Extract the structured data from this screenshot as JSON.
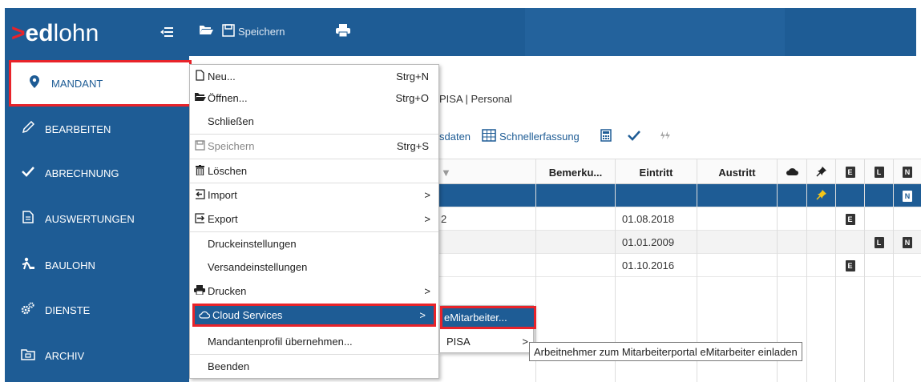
{
  "app": {
    "logo_arrow": ">",
    "logo_ed": "ed",
    "logo_lohn": "lohn",
    "menu_toggle_icon": "hamburger-icon"
  },
  "toolbar": {
    "open_icon": "folder-open-icon",
    "save_label": "Speichern",
    "print_icon": "printer-icon"
  },
  "sidebar": {
    "items": [
      {
        "label": "MANDANT",
        "icon": "map-marker-icon"
      },
      {
        "label": "BEARBEITEN",
        "icon": "pencil-icon"
      },
      {
        "label": "ABRECHNUNG",
        "icon": "checkmark-icon"
      },
      {
        "label": "AUSWERTUNGEN",
        "icon": "document-icon"
      },
      {
        "label": "BAULOHN",
        "icon": "worker-icon"
      },
      {
        "label": "DIENSTE",
        "icon": "gears-icon"
      },
      {
        "label": "ARCHIV",
        "icon": "archive-icon"
      }
    ]
  },
  "main": {
    "breadcrumb": "PISA | Personal",
    "toolbar": {
      "stammdaten_partial": "sdaten",
      "schnellerfassung": "Schnellerfassung"
    },
    "grid": {
      "headers": [
        "Bemerku...",
        "Eintritt",
        "Austritt"
      ],
      "header_sort_arrow": "▼",
      "icon_headers": [
        "cloud-icon",
        "pin-icon",
        "E",
        "L",
        "N"
      ],
      "rows": [
        {
          "partial": "",
          "bemerkung": "",
          "eintritt": "",
          "austritt": "",
          "pin": true,
          "E": false,
          "L": false,
          "N": true
        },
        {
          "partial": "2",
          "bemerkung": "",
          "eintritt": "01.08.2018",
          "austritt": "",
          "pin": false,
          "E": true,
          "L": false,
          "N": false
        },
        {
          "partial": "",
          "bemerkung": "",
          "eintritt": "01.01.2009",
          "austritt": "",
          "pin": false,
          "E": false,
          "L": true,
          "N": true
        },
        {
          "partial": "",
          "bemerkung": "",
          "eintritt": "01.10.2016",
          "austritt": "",
          "pin": false,
          "E": true,
          "L": false,
          "N": false
        }
      ]
    }
  },
  "menu": {
    "items": [
      {
        "label": "Neu...",
        "shortcut": "Strg+N",
        "icon": "new-file-icon"
      },
      {
        "label": "Öffnen...",
        "shortcut": "Strg+O",
        "icon": "folder-open-icon"
      },
      {
        "label": "Schließen",
        "shortcut": ""
      },
      {
        "label": "Speichern",
        "shortcut": "Strg+S",
        "icon": "save-icon"
      },
      {
        "label": "Löschen",
        "shortcut": "",
        "icon": "trash-icon"
      },
      {
        "label": "Import",
        "shortcut": "",
        "icon": "import-icon"
      },
      {
        "label": "Export",
        "shortcut": "",
        "icon": "export-icon"
      },
      {
        "label": "Druckeinstellungen",
        "shortcut": ""
      },
      {
        "label": "Versandeinstellungen",
        "shortcut": ""
      },
      {
        "label": "Drucken",
        "shortcut": "",
        "icon": "printer-icon"
      },
      {
        "label": "Cloud Services",
        "shortcut": "",
        "icon": "cloud-icon"
      },
      {
        "label": "Mandantenprofil übernehmen...",
        "shortcut": ""
      },
      {
        "label": "Beenden",
        "shortcut": ""
      }
    ],
    "submenu_arrow": ">"
  },
  "submenu": {
    "items": [
      {
        "label": "eMitarbeiter..."
      },
      {
        "label": "PISA"
      }
    ]
  },
  "tooltip": "Arbeitnehmer zum Mitarbeiterportal eMitarbeiter einladen",
  "colors": {
    "brand": "#1e5c95",
    "highlight_border": "#e8232a"
  }
}
